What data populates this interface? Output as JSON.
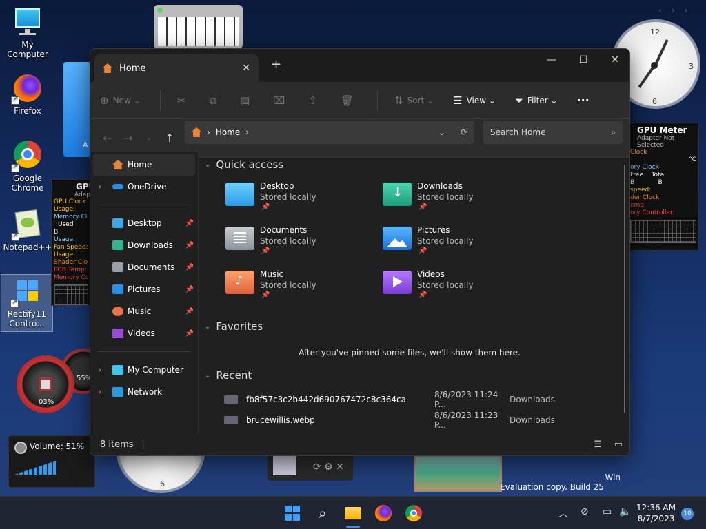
{
  "desktop": {
    "icons": [
      {
        "label": "My Computer"
      },
      {
        "label": "Firefox"
      },
      {
        "label": "Google Chrome"
      },
      {
        "label": "Notepad++"
      },
      {
        "label": "Rectify11 Contro..."
      }
    ],
    "watermark": {
      "line1": "Win",
      "line2": "Evaluation copy. Build 25"
    }
  },
  "gadgets": {
    "clock": {
      "twelve": "12",
      "three": "3",
      "six": "6"
    },
    "clock_bottom": {
      "six": "6"
    },
    "gpu_meter": {
      "title": "GPU Meter",
      "subtitle": "Adapter Not Selected",
      "rows": [
        "Clock",
        "",
        "ory Clock",
        "Free",
        "Total",
        "B",
        "B",
        "",
        "speed:",
        "",
        "der Clock",
        "emp:",
        "ory Controller:"
      ],
      "unit": "°C"
    },
    "gpu_left": {
      "title": "GPU",
      "subtitle": "Adapt",
      "rows": [
        "GPU Clock",
        "Usage:",
        "Memory Clock",
        "Used",
        "B",
        "Usage:",
        "Fan Speed:",
        "Usage:",
        "Shader Clock",
        "PCB Temp:",
        "Memory Contr"
      ]
    },
    "cpu_meter": {
      "value1": "03%",
      "value2": "55%"
    },
    "volume": {
      "label": "Volume: 51%"
    }
  },
  "window": {
    "tab_title": "Home",
    "toolbar": {
      "new_label": "New",
      "sort_label": "Sort",
      "view_label": "View",
      "filter_label": "Filter",
      "more_label": "···"
    },
    "address": {
      "crumb": "Home"
    },
    "search": {
      "placeholder": "Search Home"
    },
    "sidebar": {
      "home": "Home",
      "onedrive": "OneDrive",
      "pinned": [
        "Desktop",
        "Downloads",
        "Documents",
        "Pictures",
        "Music",
        "Videos"
      ],
      "my_computer": "My Computer",
      "network": "Network"
    },
    "quick_access": {
      "title": "Quick access",
      "items": [
        {
          "name": "Desktop",
          "sub": "Stored locally"
        },
        {
          "name": "Downloads",
          "sub": "Stored locally"
        },
        {
          "name": "Documents",
          "sub": "Stored locally"
        },
        {
          "name": "Pictures",
          "sub": "Stored locally"
        },
        {
          "name": "Music",
          "sub": "Stored locally"
        },
        {
          "name": "Videos",
          "sub": "Stored locally"
        }
      ]
    },
    "favorites": {
      "title": "Favorites",
      "empty": "After you've pinned some files, we'll show them here."
    },
    "recent": {
      "title": "Recent",
      "rows": [
        {
          "name": "fb8f57c3c2b442d690767472c8c364ca",
          "date": "8/6/2023 11:24 P...",
          "location": "Downloads"
        },
        {
          "name": "brucewillis.webp",
          "date": "8/6/2023 11:23 P...",
          "location": "Downloads"
        }
      ]
    },
    "status": {
      "count": "8 items"
    }
  },
  "taskbar": {
    "time": "12:36 AM",
    "date": "8/7/2023",
    "notifications": "10"
  },
  "colors": {
    "accent": "#4a8be0",
    "window_bg": "#202020",
    "toolbar_bg": "#2c2c2c"
  }
}
